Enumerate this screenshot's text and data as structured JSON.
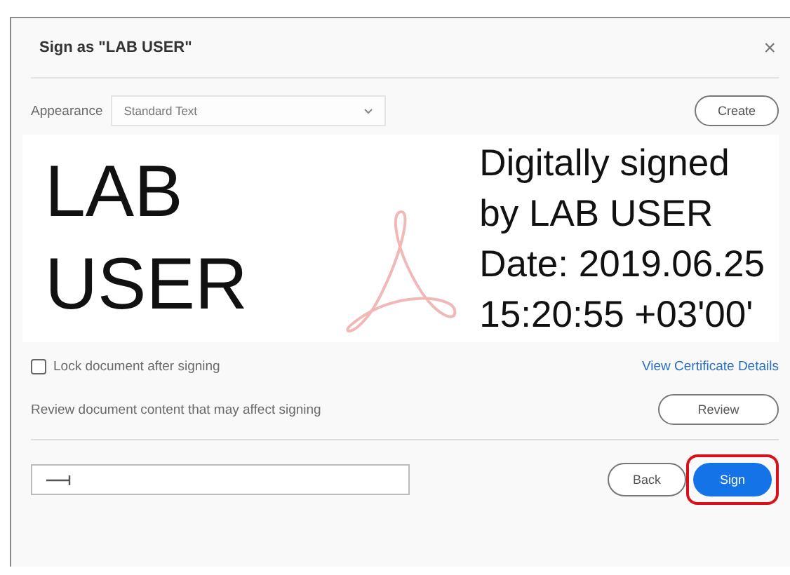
{
  "dialog": {
    "title": "Sign as \"LAB USER\"",
    "close": "×"
  },
  "appearance": {
    "label": "Appearance",
    "value": "Standard Text",
    "create": "Create"
  },
  "preview": {
    "name_lines": [
      "LAB",
      "USER"
    ],
    "details_lines": [
      "Digitally signed",
      "by LAB USER",
      "Date: 2019.06.25",
      "15:20:55 +03'00'"
    ]
  },
  "lock": {
    "label": "Lock document after signing",
    "checked": false
  },
  "certificate_link": "View Certificate Details",
  "review": {
    "text": "Review document content that may affect signing",
    "button": "Review"
  },
  "footer": {
    "back": "Back",
    "sign": "Sign",
    "sign_highlighted": true
  }
}
